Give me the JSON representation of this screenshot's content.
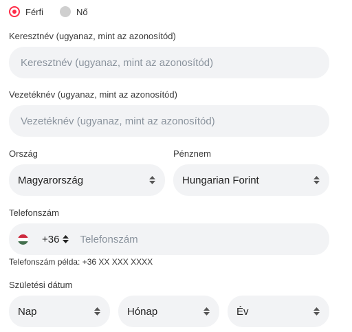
{
  "gender": {
    "options": [
      {
        "label": "Férfi",
        "checked": true
      },
      {
        "label": "Nő",
        "checked": false
      }
    ]
  },
  "first_name": {
    "label": "Keresztnév (ugyanaz, mint az azonosítód)",
    "placeholder": "Keresztnév (ugyanaz, mint az azonosítód)"
  },
  "last_name": {
    "label": "Vezetéknév (ugyanaz, mint az azonosítód)",
    "placeholder": "Vezetéknév (ugyanaz, mint az azonosítód)"
  },
  "country": {
    "label": "Ország",
    "value": "Magyarország"
  },
  "currency": {
    "label": "Pénznem",
    "value": "Hungarian Forint"
  },
  "phone": {
    "label": "Telefonszám",
    "prefix": "+36",
    "placeholder": "Telefonszám",
    "hint": "Telefonszám példa: +36 XX XXX XXXX",
    "flag_colors": [
      "#cd2a3e",
      "#ffffff",
      "#436f4d"
    ]
  },
  "birthdate": {
    "label": "Születési dátum",
    "day": "Nap",
    "month": "Hónap",
    "year": "Év"
  },
  "colors": {
    "accent": "#ff2b47",
    "field_bg": "#f2f3f5"
  }
}
